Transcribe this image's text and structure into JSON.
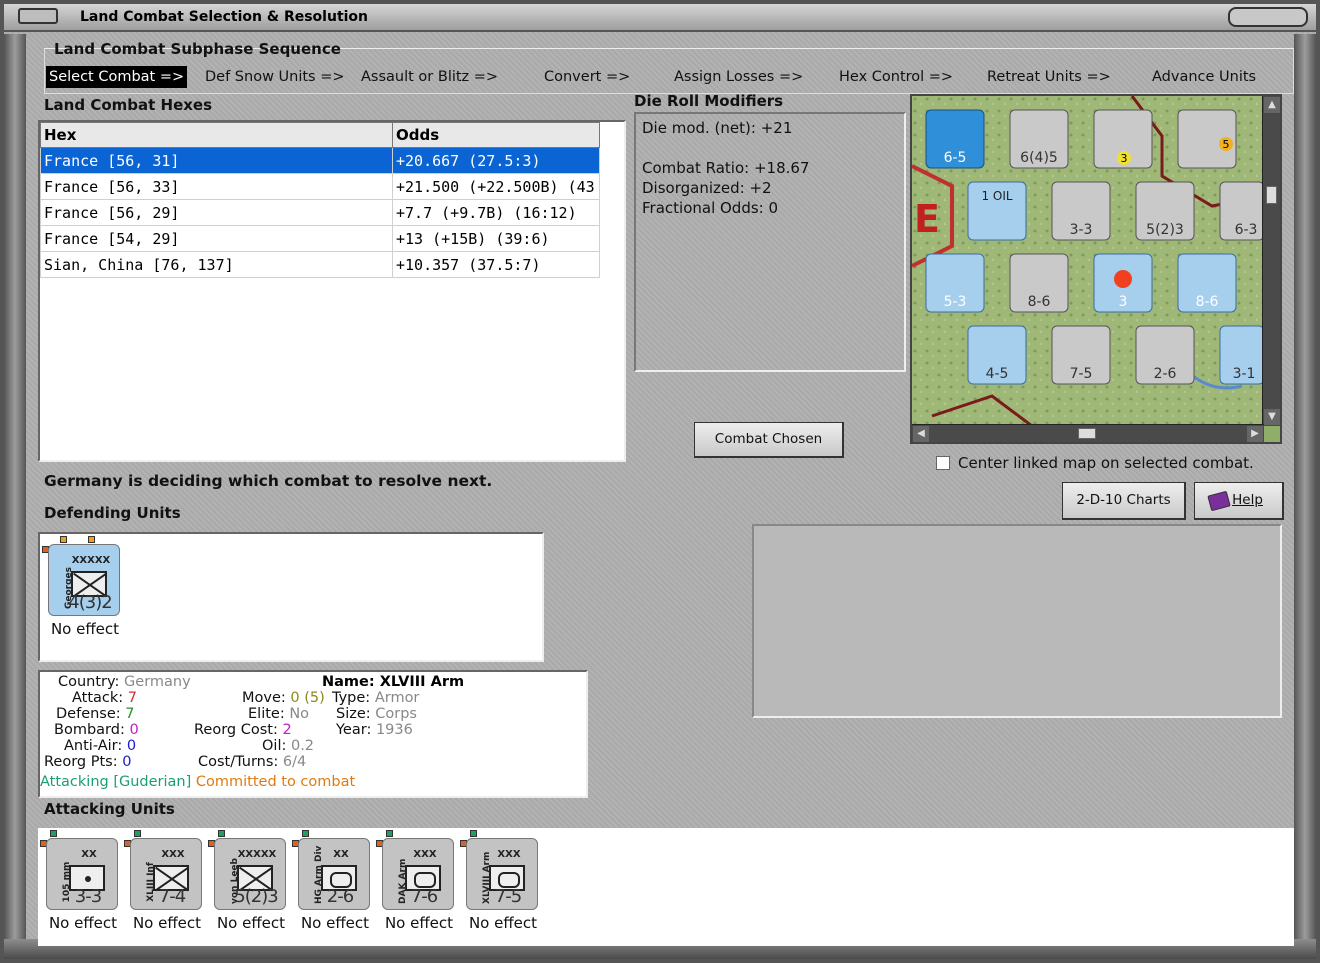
{
  "window": {
    "title": "Land Combat Selection & Resolution"
  },
  "sequence": {
    "title": "Land Combat Subphase Sequence",
    "steps": [
      "Select Combat =>",
      "Def Snow Units =>",
      "Assault or Blitz =>",
      "Convert =>",
      "Assign Losses =>",
      "Hex Control =>",
      "Retreat Units =>",
      "Advance Units"
    ],
    "active_index": 0
  },
  "hexes": {
    "title": "Land Combat Hexes",
    "columns": [
      "Hex",
      "Odds"
    ],
    "rows": [
      [
        "France [56, 31]",
        "+20.667 (27.5:3)"
      ],
      [
        "France [56, 33]",
        "+21.500 (+22.500B) (43"
      ],
      [
        "France [56, 29]",
        "+7.7 (+9.7B) (16:12)"
      ],
      [
        "France [54, 29]",
        "+13 (+15B) (39:6)"
      ],
      [
        "Sian, China [76, 137]",
        "+10.357 (37.5:7)"
      ]
    ],
    "selected_index": 0
  },
  "die_roll": {
    "title": "Die Roll Modifiers",
    "lines": [
      "Die mod. (net): +21",
      "",
      "Combat Ratio: +18.67",
      "Disorganized: +2",
      "Fractional Odds: 0"
    ]
  },
  "buttons": {
    "combat_chosen": "Combat Chosen",
    "charts": "2-D-10 Charts",
    "help": "Help"
  },
  "center_map_label": "Center linked map on selected combat.",
  "status": "Germany is deciding which combat to resolve next.",
  "defending": {
    "title": "Defending Units",
    "units": [
      {
        "name": "Georges",
        "size": "XXXXX",
        "strength": "4(3)2",
        "effect": "No effect",
        "type": "inf",
        "color": "blue"
      }
    ]
  },
  "unit_info": {
    "country_label": "Country:",
    "country": "Germany",
    "attack_label": "Attack:",
    "attack": "7",
    "defense_label": "Defense:",
    "defense": "7",
    "bombard_label": "Bombard:",
    "bombard": "0",
    "antiair_label": "Anti-Air:",
    "antiair": "0",
    "reorgpts_label": "Reorg Pts:",
    "reorgpts": "0",
    "move_label": "Move:",
    "move": "0",
    "move_extra": "(5)",
    "elite_label": "Elite:",
    "elite": "No",
    "reorgcost_label": "Reorg Cost:",
    "reorgcost": "2",
    "oil_label": "Oil:",
    "oil": "0.2",
    "costturns_label": "Cost/Turns:",
    "costturns": "6/4",
    "name_label": "Name:",
    "name": "XLVIII Arm",
    "type_label": "Type:",
    "type": "Armor",
    "size_label": "Size:",
    "size": "Corps",
    "year_label": "Year:",
    "year": "1936",
    "attacking_text": "Attacking [Guderian]",
    "committed_text": "Committed to combat"
  },
  "attacking": {
    "title": "Attacking Units",
    "units": [
      {
        "name": "105 mm",
        "size": "XX",
        "strength": "3-3",
        "effect": "No effect",
        "type": "art"
      },
      {
        "name": "XLIII Inf",
        "size": "XXX",
        "strength": "7-4",
        "effect": "No effect",
        "type": "inf"
      },
      {
        "name": "von Leeb",
        "size": "XXXXX",
        "strength": "5(2)3",
        "effect": "No effect",
        "type": "inf"
      },
      {
        "name": "HG Arm Div",
        "size": "XX",
        "strength": "2-6",
        "effect": "No effect",
        "type": "arm"
      },
      {
        "name": "DAK Arm",
        "size": "XXX",
        "strength": "7-6",
        "effect": "No effect",
        "type": "arm"
      },
      {
        "name": "XLVIII Arm",
        "size": "XXX",
        "strength": "7-5",
        "effect": "No effect",
        "type": "arm"
      }
    ]
  },
  "map": {
    "counters": [
      {
        "label": "6-5"
      },
      {
        "label": "6(4)5"
      },
      {
        "label": "3"
      },
      {
        "label": "5"
      },
      {
        "label": "1 OIL"
      },
      {
        "label": "3-3"
      },
      {
        "label": "5(2)3"
      },
      {
        "label": "6-3"
      },
      {
        "label": "5-3"
      },
      {
        "label": "8-6"
      },
      {
        "label": "3"
      },
      {
        "label": "8-6"
      },
      {
        "label": "4-5"
      },
      {
        "label": "7-5"
      },
      {
        "label": "2-6"
      },
      {
        "label": "3-1"
      }
    ],
    "letter": "E"
  }
}
